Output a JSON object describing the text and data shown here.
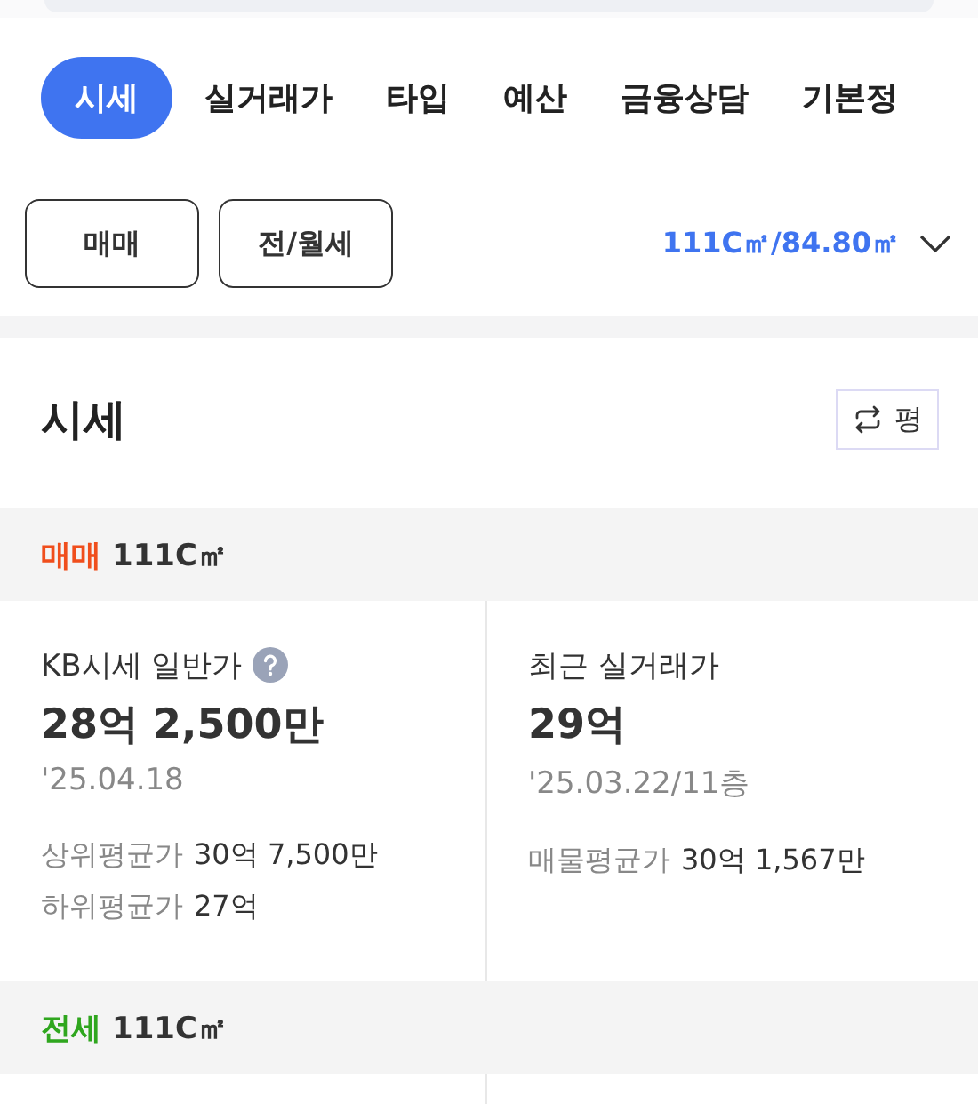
{
  "tabs": [
    {
      "label": "시세",
      "selected": true
    },
    {
      "label": "실거래가",
      "selected": false
    },
    {
      "label": "타입",
      "selected": false
    },
    {
      "label": "예산",
      "selected": false
    },
    {
      "label": "금융상담",
      "selected": false
    },
    {
      "label": "기본정",
      "selected": false
    }
  ],
  "filters": [
    "매매",
    "전/월세"
  ],
  "area_selector": "111C㎡/84.80㎡",
  "section": {
    "title": "시세",
    "unit_toggle": "평"
  },
  "groups": [
    {
      "deal": "매매",
      "color": "#f04e1c",
      "area": "111C㎡",
      "cells": [
        {
          "label": "KB시세 일반가",
          "help": true,
          "value": "28억 2,500만",
          "date": "'25.04.18",
          "stats": [
            {
              "label": "상위평균가",
              "value": "30억 7,500만"
            },
            {
              "label": "하위평균가",
              "value": "27억"
            }
          ]
        },
        {
          "label": "최근 실거래가",
          "help": false,
          "value": "29억",
          "date": "'25.03.22/11층",
          "stats": [
            {
              "label": "매물평균가",
              "value": "30억 1,567만"
            }
          ]
        }
      ]
    },
    {
      "deal": "전세",
      "color": "#2fa61e",
      "area": "111C㎡"
    }
  ]
}
